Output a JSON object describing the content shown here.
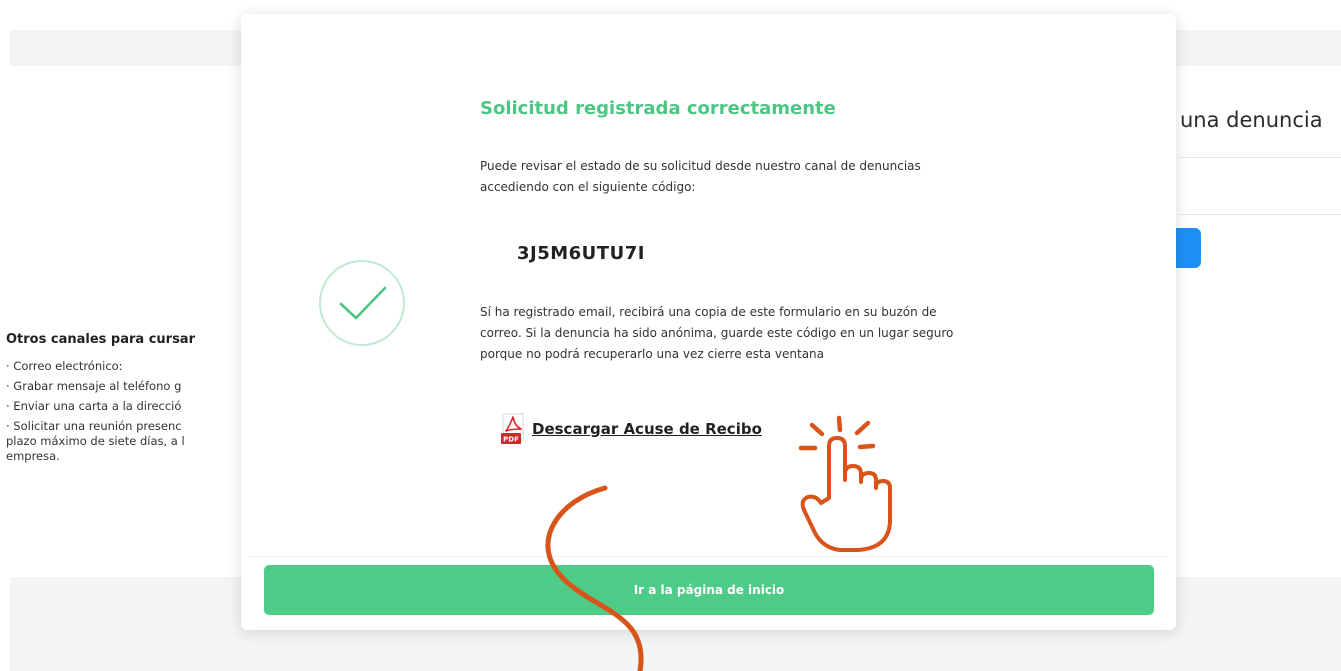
{
  "background": {
    "heading": "una denuncia",
    "left_panel": {
      "title": "Otros canales para cursar",
      "items": [
        "· Correo electrónico:",
        "· Grabar mensaje al teléfono g",
        "· Enviar una carta a la direcció",
        "· Solicitar una reunión presenc",
        "plazo máximo de siete días, a l",
        "empresa."
      ]
    }
  },
  "modal": {
    "title": "Solicitud registrada correctamente",
    "intro_line1": "Puede revisar el estado de su solicitud desde nuestro canal de denuncias",
    "intro_line2": "accediendo con el siguiente código:",
    "code": "3J5M6UTU7I",
    "note_line1": "Sí ha registrado email, recibirá una copia de este formulario en su buzón de",
    "note_line2": "correo. Si la denuncia ha sido anónima, guarde este código en un lugar seguro",
    "note_line3": "porque no podrá recuperarlo una vez cierre esta ventana",
    "pdf_icon_text": "PDF",
    "download_label": "Descargar Acuse de Recibo",
    "home_button": "Ir a la página de inicio"
  },
  "colors": {
    "accent_green": "#4dc584",
    "button_green": "#4dcb87",
    "annotation_orange": "#d9541b",
    "blue_button": "#1e90f5"
  },
  "icons": [
    "check-icon",
    "pdf-icon",
    "pointing-hand-icon",
    "curve-arrow-annotation"
  ]
}
